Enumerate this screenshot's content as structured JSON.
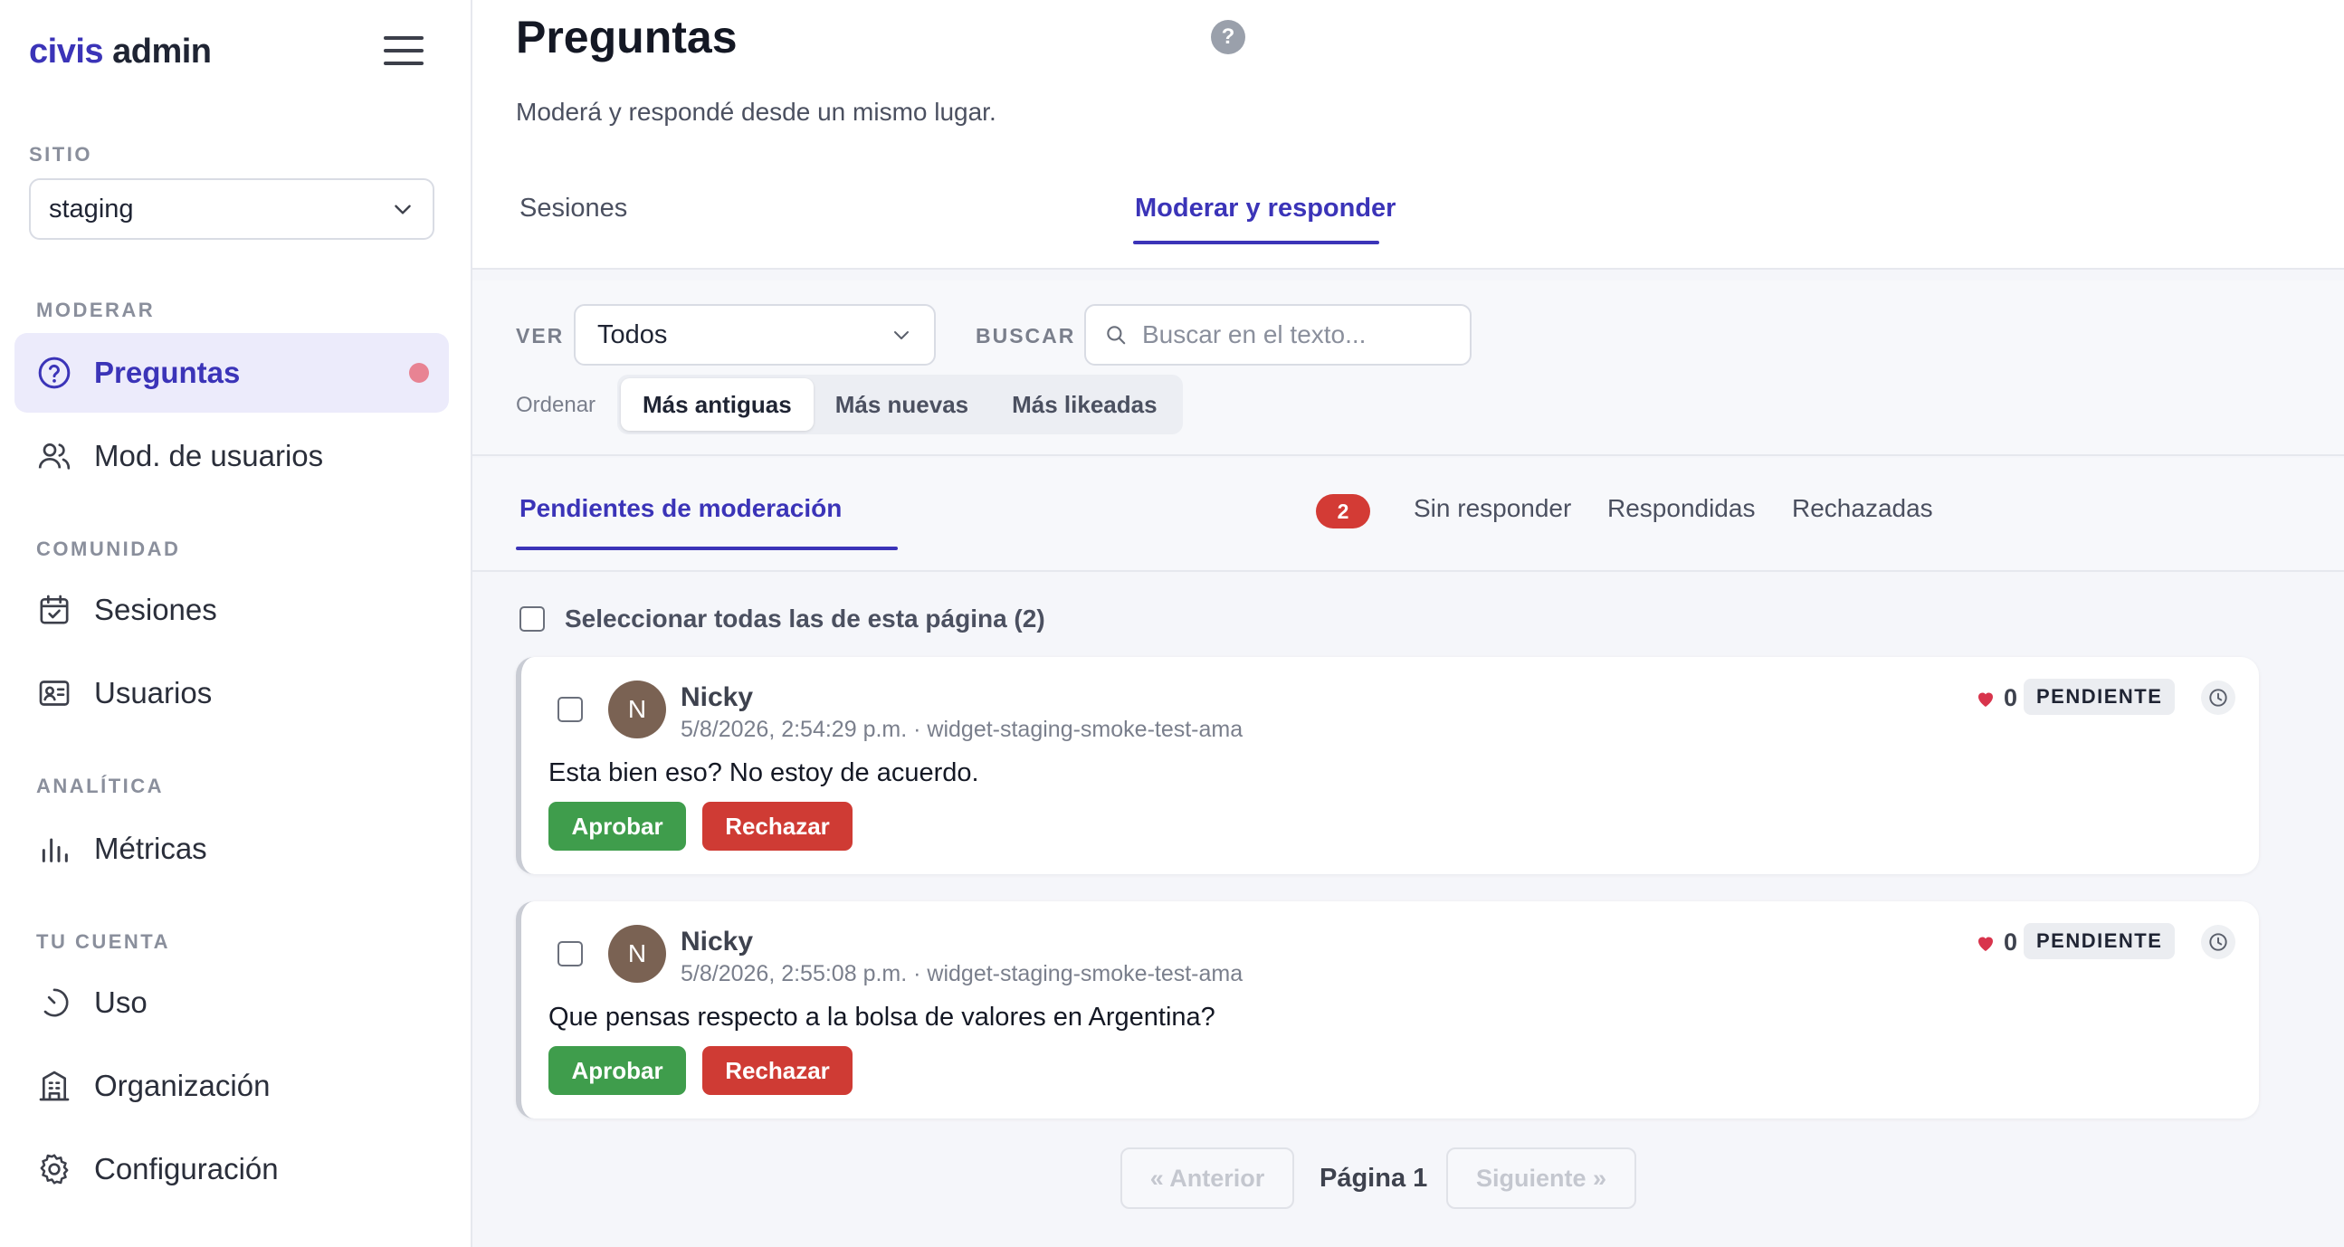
{
  "brand": {
    "part1": "civis",
    "part2": "admin"
  },
  "sidebar": {
    "site_label": "SITIO",
    "site_value": "staging",
    "sections": [
      {
        "label": "MODERAR",
        "items": [
          {
            "label": "Preguntas",
            "icon": "question-circle-icon",
            "active": true
          },
          {
            "label": "Mod. de usuarios",
            "icon": "users-icon"
          }
        ]
      },
      {
        "label": "COMUNIDAD",
        "items": [
          {
            "label": "Sesiones",
            "icon": "calendar-check-icon"
          },
          {
            "label": "Usuarios",
            "icon": "id-card-icon"
          }
        ]
      },
      {
        "label": "ANALÍTICA",
        "items": [
          {
            "label": "Métricas",
            "icon": "bar-chart-icon"
          }
        ]
      },
      {
        "label": "TU CUENTA",
        "items": [
          {
            "label": "Uso",
            "icon": "gauge-icon"
          },
          {
            "label": "Organización",
            "icon": "building-icon"
          },
          {
            "label": "Configuración",
            "icon": "gear-icon"
          }
        ]
      }
    ]
  },
  "header": {
    "title": "Preguntas",
    "help": "?",
    "subtitle": "Moderá y respondé desde un mismo lugar.",
    "tabs": [
      "Sesiones",
      "Moderar y responder"
    ]
  },
  "filters": {
    "ver_label": "VER",
    "ver_value": "Todos",
    "buscar_label": "BUSCAR",
    "search_placeholder": "Buscar en el texto...",
    "sort_label": "Ordenar",
    "sort_options": [
      "Más antiguas",
      "Más nuevas",
      "Más likeadas"
    ]
  },
  "subtabs": {
    "items": [
      "Pendientes de moderación",
      "Sin responder",
      "Respondidas",
      "Rechazadas"
    ],
    "pending_count": "2"
  },
  "select_all_label": "Seleccionar todas las de esta página (2)",
  "questions": [
    {
      "initial": "N",
      "author": "Nicky",
      "meta": "5/8/2026, 2:54:29 p.m. · widget-staging-smoke-test-ama",
      "text": "Esta bien eso? No estoy de acuerdo.",
      "likes": "0",
      "status": "PENDIENTE",
      "approve": "Aprobar",
      "reject": "Rechazar"
    },
    {
      "initial": "N",
      "author": "Nicky",
      "meta": "5/8/2026, 2:55:08 p.m. · widget-staging-smoke-test-ama",
      "text": "Que pensas respecto a la bolsa de valores en Argentina?",
      "likes": "0",
      "status": "PENDIENTE",
      "approve": "Aprobar",
      "reject": "Rechazar"
    }
  ],
  "pagination": {
    "prev": "« Anterior",
    "page": "Página 1",
    "next": "Siguiente »"
  },
  "colors": {
    "accent": "#3b34b8",
    "approve": "#3f9d4c",
    "reject": "#cf3b34",
    "notification_dot": "#e88393"
  }
}
